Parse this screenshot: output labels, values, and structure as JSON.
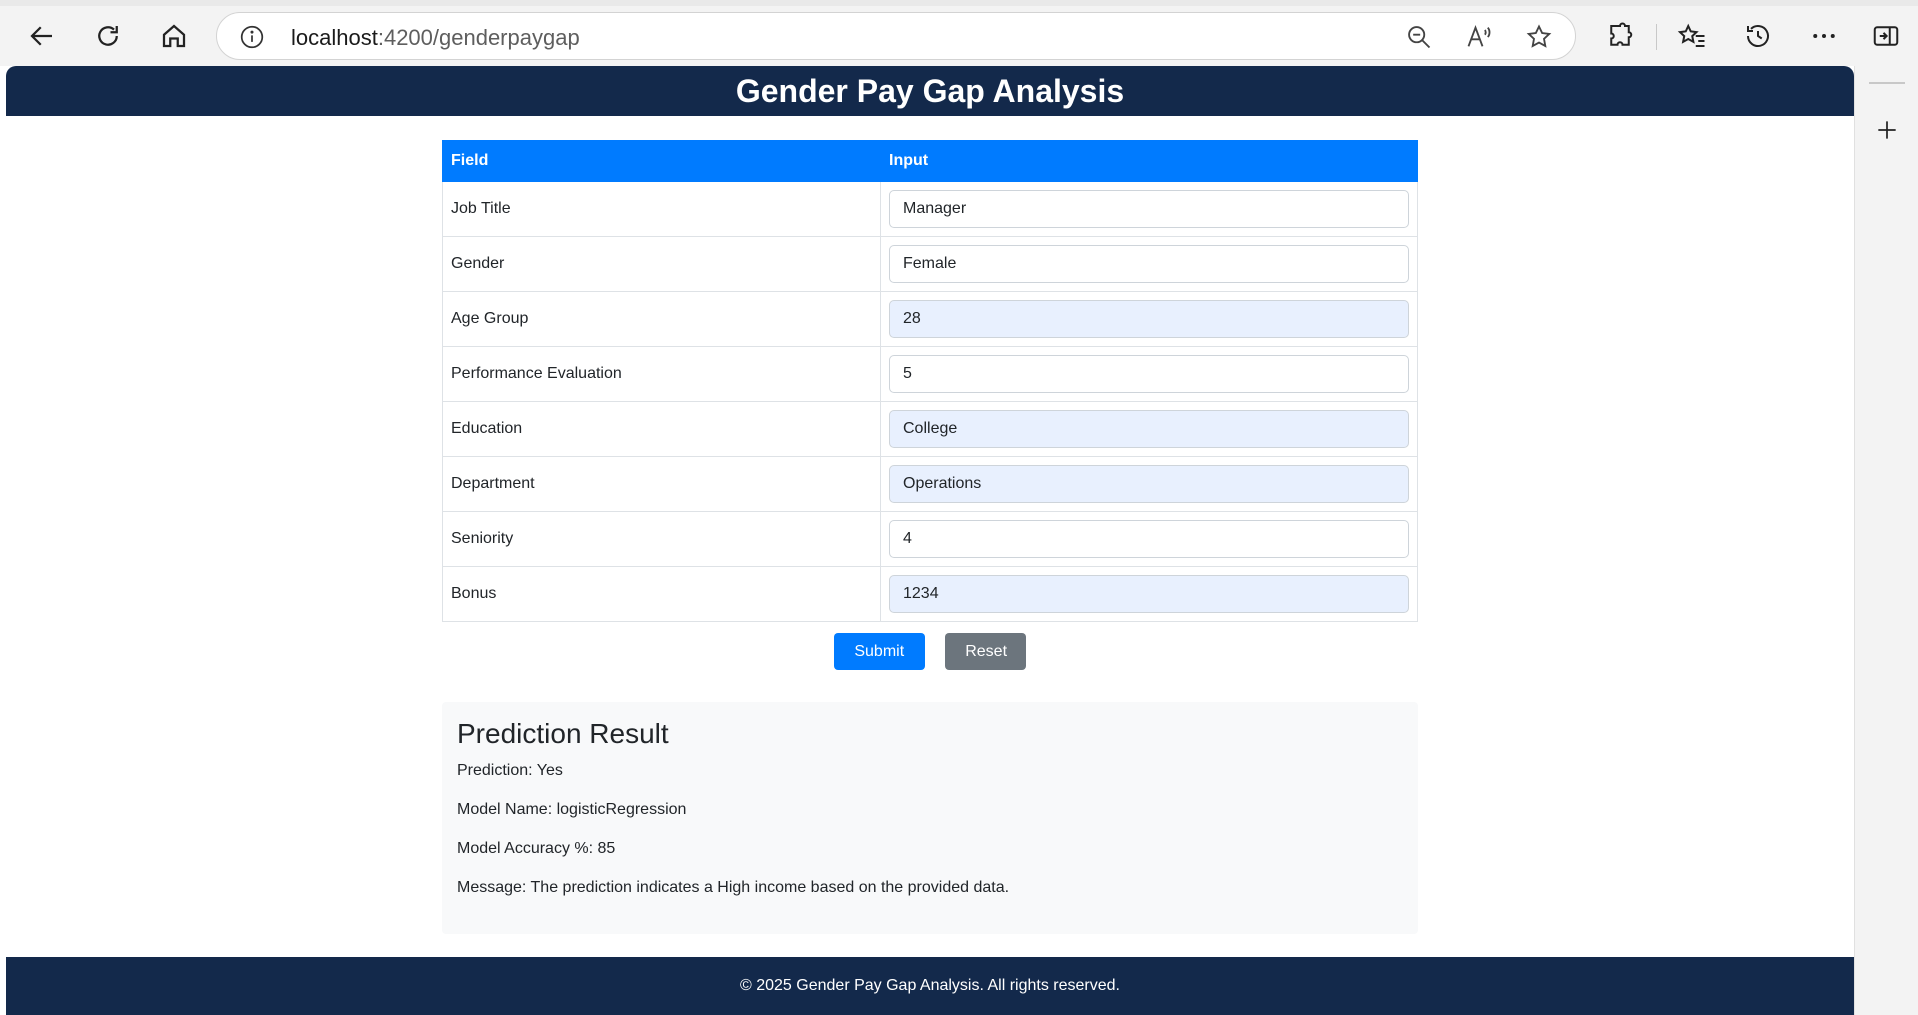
{
  "browser": {
    "url_host": "localhost",
    "url_path": ":4200/genderpaygap",
    "icons": [
      "back-icon",
      "refresh-icon",
      "home-icon",
      "info-icon",
      "zoom-out-icon",
      "read-aloud-icon",
      "favorite-star-icon",
      "extensions-icon",
      "favorites-icon",
      "history-icon",
      "more-icon",
      "sidebar-toggle-icon",
      "add-icon"
    ]
  },
  "header": {
    "title": "Gender Pay Gap Analysis"
  },
  "form": {
    "col_field": "Field",
    "col_input": "Input",
    "rows": [
      {
        "label": "Job Title",
        "value": "Manager",
        "autofilled": false
      },
      {
        "label": "Gender",
        "value": "Female",
        "autofilled": false
      },
      {
        "label": "Age Group",
        "value": "28",
        "autofilled": true
      },
      {
        "label": "Performance Evaluation",
        "value": "5",
        "autofilled": false
      },
      {
        "label": "Education",
        "value": "College",
        "autofilled": true
      },
      {
        "label": "Department",
        "value": "Operations",
        "autofilled": true
      },
      {
        "label": "Seniority",
        "value": "4",
        "autofilled": false
      },
      {
        "label": "Bonus",
        "value": "1234",
        "autofilled": true
      }
    ],
    "submit_label": "Submit",
    "reset_label": "Reset"
  },
  "result": {
    "title": "Prediction Result",
    "prediction": "Prediction: Yes",
    "model_name": "Model Name: logisticRegression",
    "accuracy": "Model Accuracy %: 85",
    "message": "Message: The prediction indicates a High income based on the provided data."
  },
  "footer": {
    "text": "© 2025 Gender Pay Gap Analysis. All rights reserved."
  },
  "colors": {
    "navy": "#13294b",
    "primary": "#007bff",
    "secondary": "#6c757d",
    "autofill": "#e8f0fe"
  }
}
